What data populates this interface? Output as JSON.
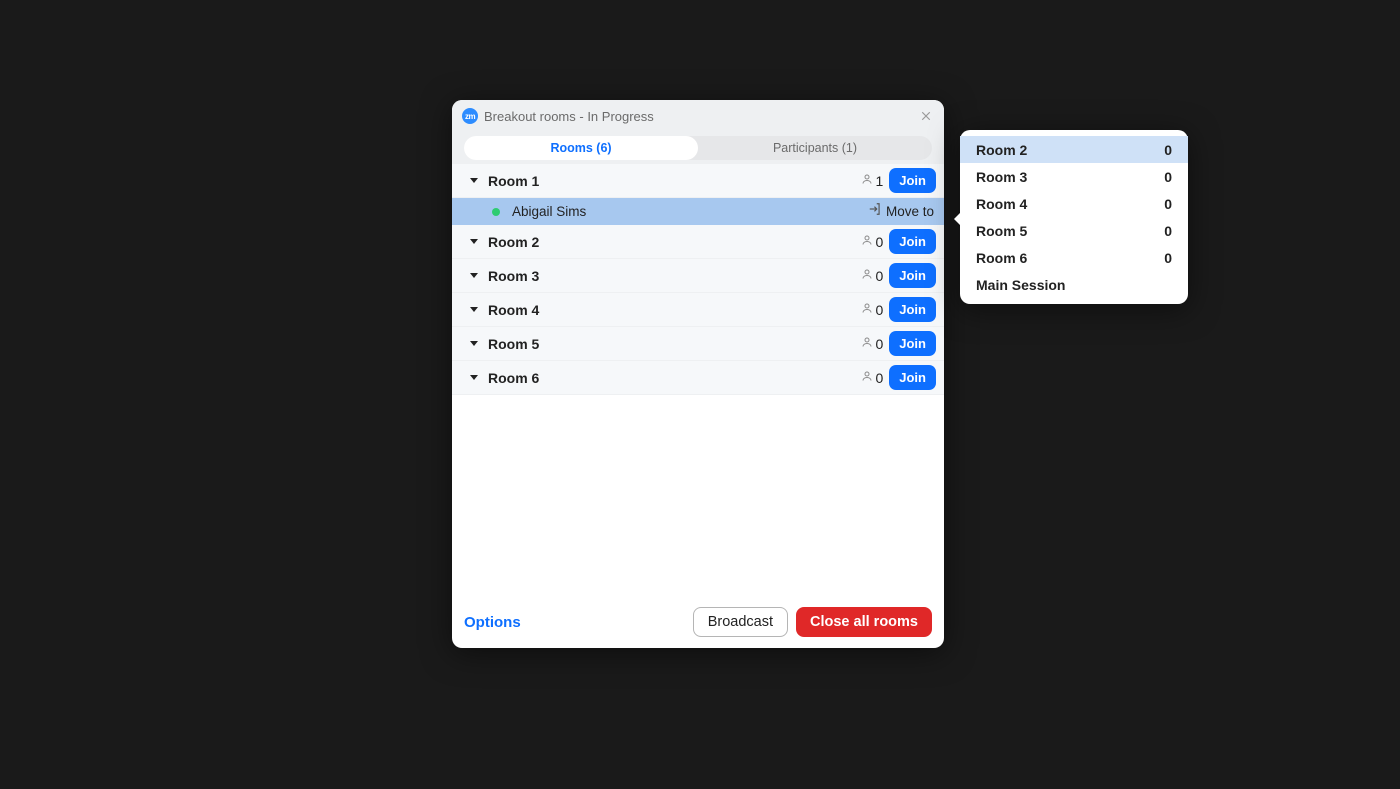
{
  "dialog": {
    "app_badge": "zm",
    "title": "Breakout rooms - In Progress",
    "tabs": {
      "rooms_label": "Rooms (6)",
      "participants_label": "Participants (1)"
    },
    "rooms": [
      {
        "name": "Room 1",
        "count": "1",
        "join": "Join",
        "participants": [
          {
            "name": "Abigail Sims",
            "move_label": "Move to"
          }
        ]
      },
      {
        "name": "Room 2",
        "count": "0",
        "join": "Join",
        "participants": []
      },
      {
        "name": "Room 3",
        "count": "0",
        "join": "Join",
        "participants": []
      },
      {
        "name": "Room 4",
        "count": "0",
        "join": "Join",
        "participants": []
      },
      {
        "name": "Room 5",
        "count": "0",
        "join": "Join",
        "participants": []
      },
      {
        "name": "Room 6",
        "count": "0",
        "join": "Join",
        "participants": []
      }
    ],
    "footer": {
      "options": "Options",
      "broadcast": "Broadcast",
      "close_all": "Close all rooms"
    }
  },
  "move_popup": {
    "items": [
      {
        "name": "Room 2",
        "count": "0",
        "highlight": true
      },
      {
        "name": "Room 3",
        "count": "0",
        "highlight": false
      },
      {
        "name": "Room 4",
        "count": "0",
        "highlight": false
      },
      {
        "name": "Room 5",
        "count": "0",
        "highlight": false
      },
      {
        "name": "Room 6",
        "count": "0",
        "highlight": false
      },
      {
        "name": "Main Session",
        "count": "",
        "highlight": false
      }
    ]
  }
}
